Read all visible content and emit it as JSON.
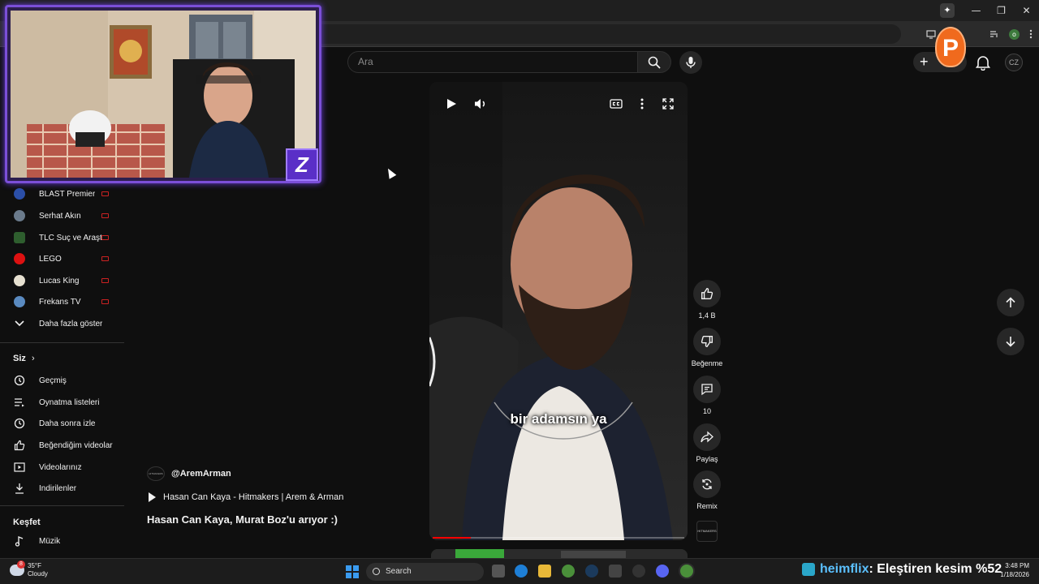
{
  "browser": {
    "window_controls": [
      "—",
      "❐",
      "✕"
    ],
    "ai_button": "✦",
    "profile_initial": "o",
    "extension_label": "P"
  },
  "header": {
    "search_placeholder": "Ara",
    "create_label": "+",
    "avatar_initials": "CZ"
  },
  "sidebar": {
    "subscriptions": [
      {
        "label": "BLAST Premier",
        "color": "#2b4fa8"
      },
      {
        "label": "Serhat Akın",
        "color": "#6b7b8c"
      },
      {
        "label": "TLC Suç ve Araşt...",
        "color": "#2e5e2e"
      },
      {
        "label": "LEGO",
        "color": "#d11"
      },
      {
        "label": "Lucas King",
        "color": "#e6e0d0"
      },
      {
        "label": "Frekans TV",
        "color": "#5a8ac0"
      }
    ],
    "show_more": "Daha fazla göster",
    "you_header": "Siz",
    "you_items": [
      {
        "label": "Geçmiş",
        "icon": "history-icon"
      },
      {
        "label": "Oynatma listeleri",
        "icon": "playlist-icon"
      },
      {
        "label": "Daha sonra izle",
        "icon": "clock-icon"
      },
      {
        "label": "Beğendiğim videolar",
        "icon": "thumbs-up-icon"
      },
      {
        "label": "Videolarınız",
        "icon": "video-icon"
      },
      {
        "label": "İndirilenler",
        "icon": "download-icon"
      }
    ],
    "explore_header": "Keşfet",
    "explore_items": [
      {
        "label": "Müzik",
        "icon": "music-icon"
      }
    ]
  },
  "webcam": {
    "logo_text": "Z",
    "cushion_text": "P"
  },
  "short": {
    "caption": "bir adamsın ya",
    "progress": 0.15
  },
  "actions": {
    "like_count": "1,4 B",
    "dislike_label": "Beğenme",
    "comment_count": "10",
    "share_label": "Paylaş",
    "remix_label": "Remix",
    "remix_thumb_text": "HITMAKERS"
  },
  "video_info": {
    "channel_handle": "@AremArman",
    "channel_avatar_text": "HITMAKERS",
    "music": "Hasan Can Kaya - Hitmakers | Arem & Arman",
    "title": "Hasan Can Kaya, Murat Boz'u arıyor :)"
  },
  "taskbar": {
    "temperature": "35°F",
    "condition": "Cloudy",
    "weather_badge": "8",
    "search_label": "Search",
    "ticker_brand": "heimflix",
    "ticker_text": ": Eleştiren kesim %52",
    "time": "3:48 PM",
    "date": "1/18/2026"
  },
  "colors": {
    "accent": "#ff0000",
    "webcam_border": "#7b4fd8",
    "background": "#0f0f0f"
  }
}
